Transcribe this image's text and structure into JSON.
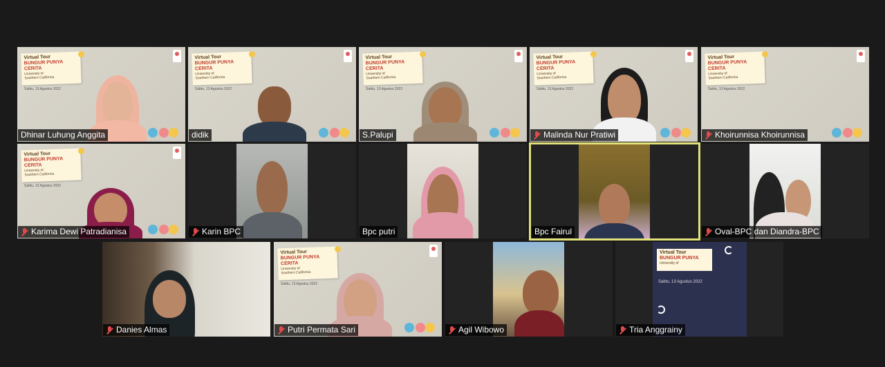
{
  "participants": [
    {
      "name": "Dhinar Luhung Anggita",
      "muted": false,
      "poster": true
    },
    {
      "name": "didik",
      "muted": false,
      "poster": true
    },
    {
      "name": "S.Palupi",
      "muted": false,
      "poster": true
    },
    {
      "name": "Malinda Nur Pratiwi",
      "muted": true,
      "poster": true
    },
    {
      "name": "Khoirunnisa Khoirunnisa",
      "muted": true,
      "poster": true
    },
    {
      "name": "Karima Dewi Patradianisa",
      "muted": true,
      "poster": true
    },
    {
      "name": "Karin BPC",
      "muted": true,
      "poster": false
    },
    {
      "name": "Bpc putri",
      "muted": false,
      "poster": false
    },
    {
      "name": "Bpc Fairul",
      "muted": false,
      "poster": false,
      "active_speaker": true
    },
    {
      "name": "Oval-BPC dan Diandra-BPC",
      "muted": true,
      "poster": false
    },
    {
      "name": "Danies Almas",
      "muted": true,
      "poster": false
    },
    {
      "name": "Putri Permata Sari",
      "muted": true,
      "poster": true
    },
    {
      "name": "Agil Wibowo",
      "muted": true,
      "poster": false
    },
    {
      "name": "Tria Anggrainy",
      "muted": true,
      "poster": true
    }
  ],
  "poster": {
    "line1": "Virtual Tour",
    "line2": "BUNGUR PUNYA",
    "line3": "CERITA",
    "line4": "University of",
    "line5": "Southern California",
    "date": "Sabtu, 13 Agustus 2022"
  },
  "colors": {
    "active_border": "#e3e27a",
    "muted_icon": "#e04a4a",
    "background": "#1a1a1a"
  }
}
